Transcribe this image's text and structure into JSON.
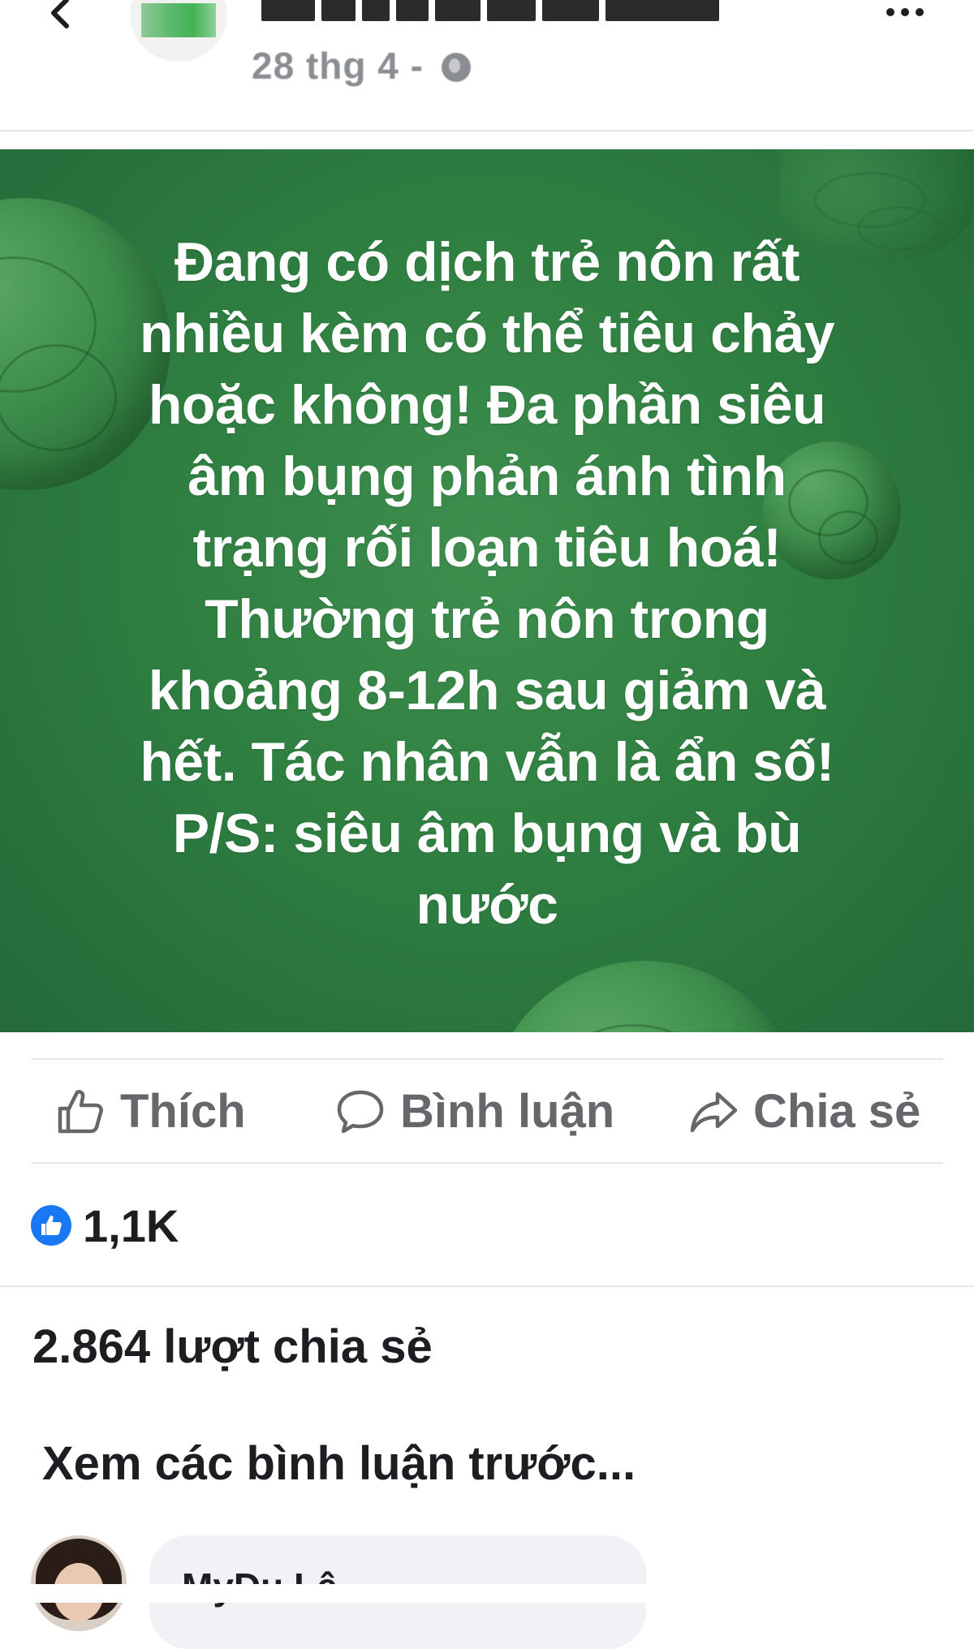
{
  "header": {
    "post_time": "28 thg 4 -",
    "icons": {
      "back": "chevron-left-icon",
      "privacy": "globe-icon",
      "more": "more-dots-icon"
    }
  },
  "post": {
    "lines": [
      "Đang có dịch trẻ nôn rất",
      "nhiều kèm có thể tiêu chảy",
      "hoặc không! Đa phần siêu",
      "âm bụng phản ánh tình",
      "trạng rối loạn tiêu hoá!",
      "Thường trẻ nôn trong",
      "khoảng 8-12h sau giảm và",
      "hết. Tác nhân vẫn là ẩn số!",
      "P/S: siêu âm bụng và bù",
      "nước"
    ],
    "background_color": "#2f7f41"
  },
  "actions": {
    "like_label": "Thích",
    "comment_label": "Bình luận",
    "share_label": "Chia sẻ"
  },
  "stats": {
    "reaction_count": "1,1K",
    "share_count": "2.864 lượt chia sẻ"
  },
  "comments": {
    "view_previous": "Xem các bình luận trước...",
    "first_author": "MyDu Lê"
  },
  "colors": {
    "accent": "#1877f2",
    "muted_text": "#65676b",
    "bubble": "#f0f2f5"
  }
}
